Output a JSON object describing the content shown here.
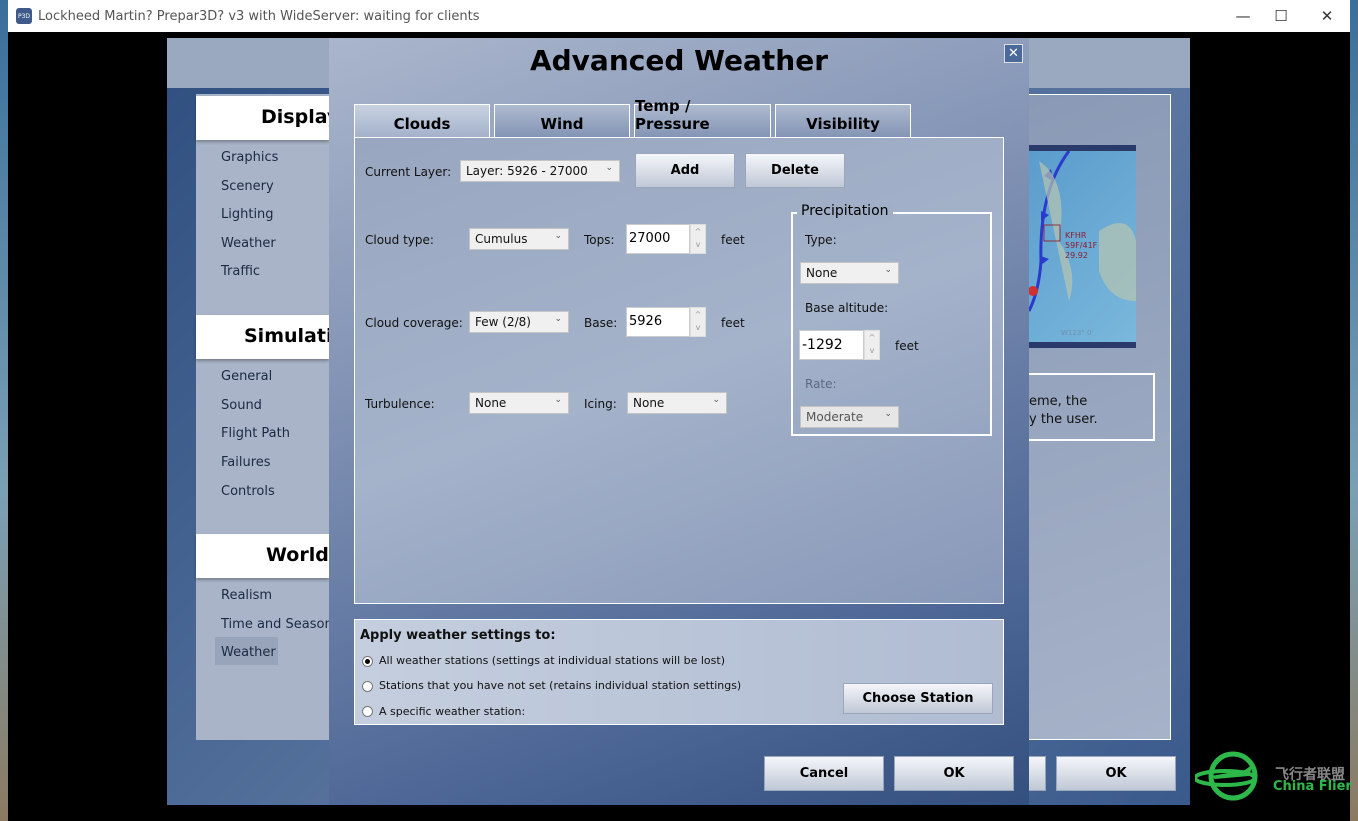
{
  "window": {
    "title": "Lockheed Martin? Prepar3D? v3 with WideServer: waiting for clients",
    "icon_text": "P3D",
    "minimize": "—",
    "maximize": "☐",
    "close": "✕"
  },
  "settings": {
    "sections": [
      {
        "title": "Display",
        "items": [
          "Graphics",
          "Scenery",
          "Lighting",
          "Weather",
          "Traffic"
        ]
      },
      {
        "title": "Simulation",
        "items": [
          "General",
          "Sound",
          "Flight Path",
          "Failures",
          "Controls"
        ]
      },
      {
        "title": "World",
        "items": [
          "Realism",
          "Time and Season",
          "Weather"
        ]
      }
    ],
    "selected_item": "Weather",
    "map": {
      "station": "KFHR",
      "temp": "59F/41F",
      "pressure": "29.92",
      "coord": "W123° 0'"
    },
    "description": [
      "eme, the",
      "y the user."
    ],
    "ok_label": "OK"
  },
  "dialog": {
    "title": "Advanced Weather",
    "close": "✕",
    "tabs": [
      "Clouds",
      "Wind",
      "Temp / Pressure",
      "Visibility"
    ],
    "active_tab": "Clouds",
    "clouds": {
      "current_layer_label": "Current Layer:",
      "current_layer": "Layer: 5926 - 27000",
      "add": "Add",
      "delete": "Delete",
      "cloud_type_label": "Cloud type:",
      "cloud_type": "Cumulus",
      "tops_label": "Tops:",
      "tops": "27000",
      "coverage_label": "Cloud coverage:",
      "coverage": "Few (2/8)",
      "base_label": "Base:",
      "base": "5926",
      "feet": "feet",
      "turbulence_label": "Turbulence:",
      "turbulence": "None",
      "icing_label": "Icing:",
      "icing": "None"
    },
    "precipitation": {
      "title": "Precipitation",
      "type_label": "Type:",
      "type": "None",
      "base_label": "Base altitude:",
      "base": "-1292",
      "feet": "feet",
      "rate_label": "Rate:",
      "rate": "Moderate"
    },
    "apply": {
      "title": "Apply weather settings to:",
      "options": [
        "All weather stations (settings at individual stations will be lost)",
        "Stations that you have not set (retains individual station settings)",
        "A specific weather station:"
      ],
      "selected": 0,
      "choose_station": "Choose Station"
    },
    "cancel": "Cancel",
    "ok": "OK"
  },
  "watermark": {
    "cn": "飞行者联盟",
    "en": "China Flier",
    "color": "#2db84a"
  }
}
